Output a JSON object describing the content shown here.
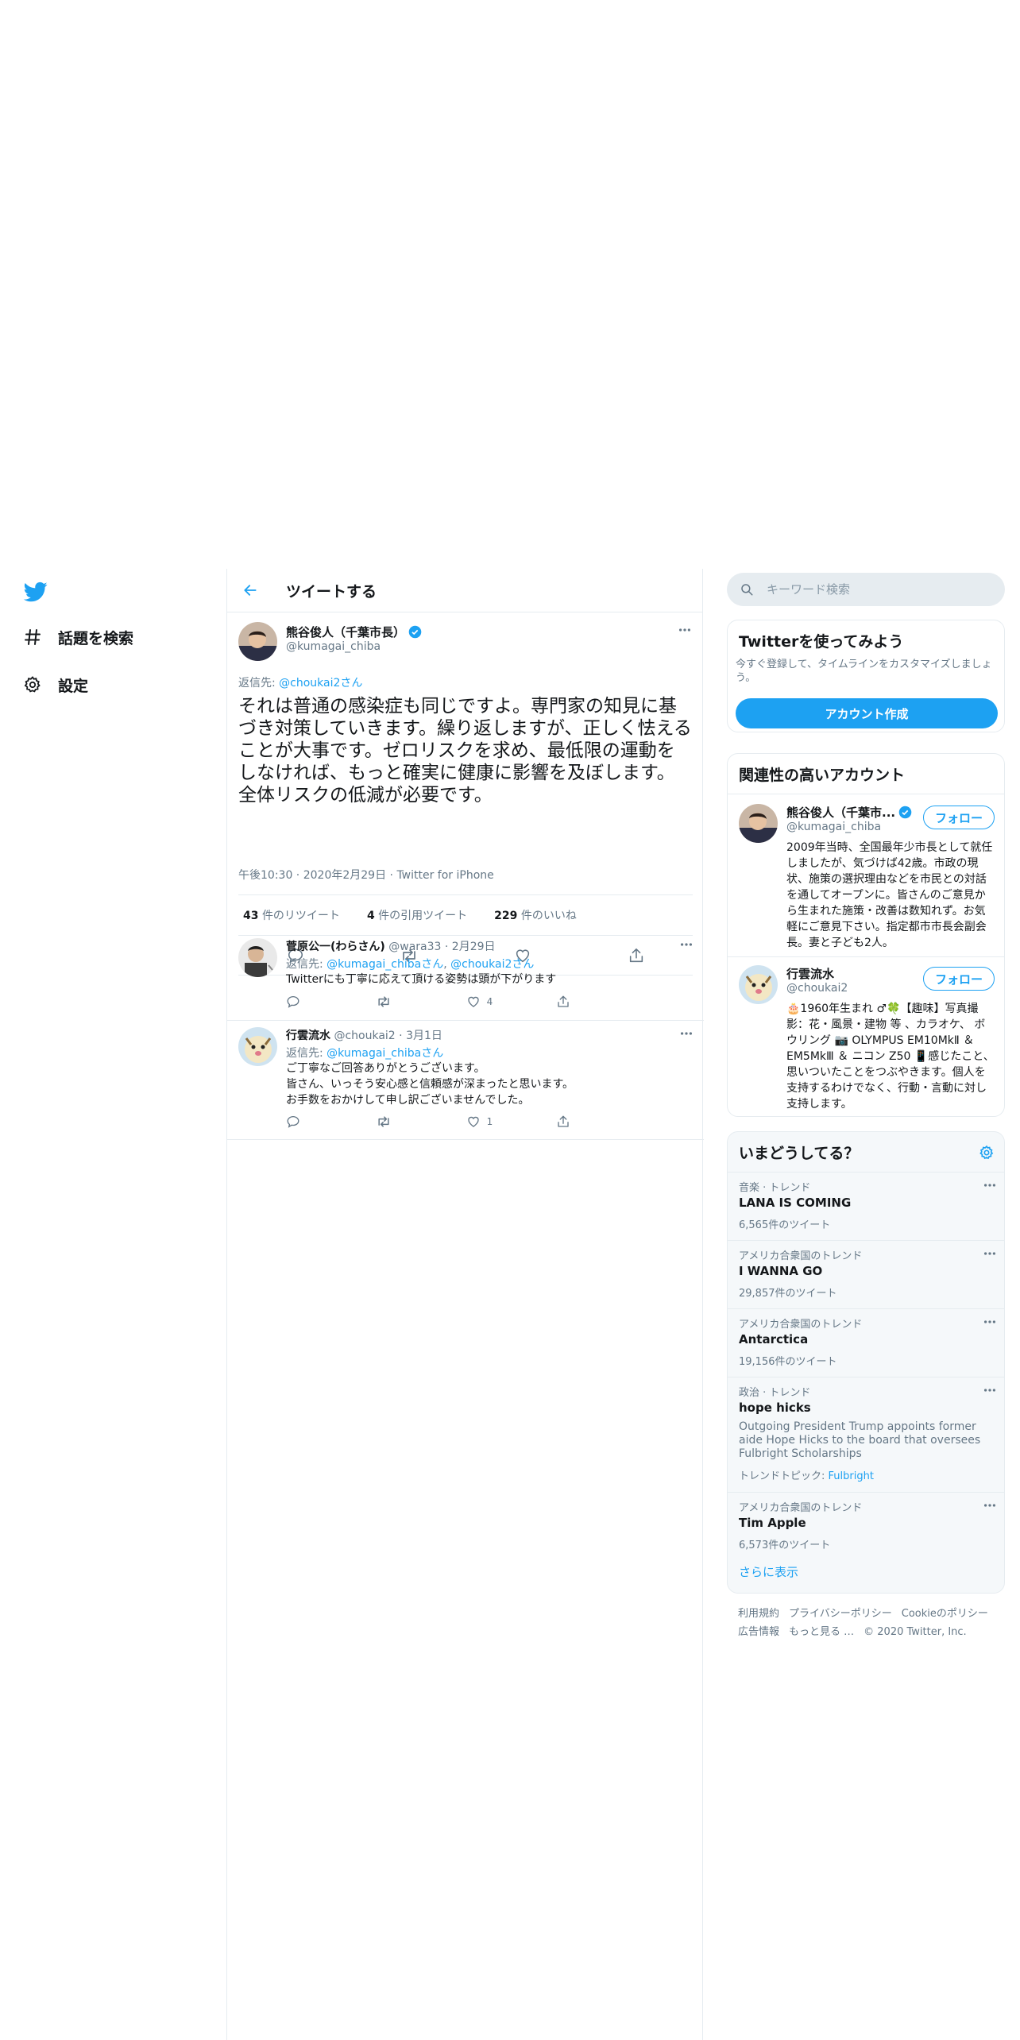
{
  "nav": {
    "explore": "話題を検索",
    "settings": "設定"
  },
  "header": {
    "title": "ツイートする"
  },
  "main_tweet": {
    "name": "熊谷俊人（千葉市長）",
    "handle": "@kumagai_chiba",
    "reply_prefix": "返信先: ",
    "reply_to": "@choukai2さん",
    "text": "それは普通の感染症も同じですよ。専門家の知見に基づき対策していきます。繰り返しますが、正しく怯えることが大事です。ゼロリスクを求め、最低限の運動をしなければ、もっと確実に健康に影響を及ぼします。全体リスクの低減が必要です。",
    "time": "午後10:30",
    "date": "2020年2月29日",
    "source": "Twitter for iPhone",
    "retweets_num": "43",
    "retweets_lbl": "件のリツイート",
    "quotes_num": "4",
    "quotes_lbl": "件の引用ツイート",
    "likes_num": "229",
    "likes_lbl": "件のいいね"
  },
  "replies": [
    {
      "name": "菅原公一(わらさん)",
      "handle": "@wara33",
      "date": "2月29日",
      "reply_prefix": "返信先: ",
      "reply_to_1": "@kumagai_chibaさん",
      "reply_to_sep": ", ",
      "reply_to_2": "@choukai2さん",
      "lines": [
        "Twitterにも丁寧に応えて頂ける姿勢は頭が下がります"
      ],
      "like_count": "4"
    },
    {
      "name": "行雲流水",
      "handle": "@choukai2",
      "date": "3月1日",
      "reply_prefix": "返信先: ",
      "reply_to_1": "@kumagai_chibaさん",
      "lines": [
        "ご丁寧なご回答ありがとうございます。",
        "皆さん、いっそう安心感と信頼感が深まったと思います。",
        "お手数をおかけして申し訳ございませんでした。"
      ],
      "like_count": "1"
    }
  ],
  "search": {
    "placeholder": "キーワード検索"
  },
  "join": {
    "title": "Twitterを使ってみよう",
    "subtitle": "今すぐ登録して、タイムラインをカスタマイズしましょう。",
    "button": "アカウント作成"
  },
  "who_to_follow": {
    "title": "関連性の高いアカウント",
    "follow_label": "フォロー",
    "accounts": [
      {
        "name": "熊谷俊人（千葉市...",
        "handle": "@kumagai_chiba",
        "bio": "2009年当時、全国最年少市長として就任しましたが、気づけば42歳。市政の現状、施策の選択理由などを市民との対話を通してオープンに。皆さんのご意見から生まれた施策・改善は数知れず。お気軽にご意見下さい。指定都市市長会副会長。妻と子ども2人。"
      },
      {
        "name": "行雲流水",
        "handle": "@choukai2",
        "bio": "🎂1960年生まれ ♂🍀【趣味】写真撮影：花・風景・建物 等 、カラオケ、 ボウリング 📷 OLYMPUS EM10MkⅡ ＆ EM5MkⅢ ＆ ニコン Z50 📱感じたこと、思いついたことをつぶやきます。個人を支持するわけでなく、行動・言動に対し支持します。"
      }
    ]
  },
  "trends": {
    "title": "いまどうしてる？",
    "items": [
      {
        "context": "音楽 · トレンド",
        "name": "LANA IS COMING",
        "count": "6,565件のツイート"
      },
      {
        "context": "アメリカ合衆国のトレンド",
        "name": "I WANNA GO",
        "count": "29,857件のツイート"
      },
      {
        "context": "アメリカ合衆国のトレンド",
        "name": "Antarctica",
        "count": "19,156件のツイート"
      },
      {
        "context": "政治 · トレンド",
        "name": "hope hicks",
        "description": "Outgoing President Trump appoints former aide Hope Hicks to the board that oversees Fulbright Scholarships",
        "topic_prefix": "トレンドトピック: ",
        "topic": "Fulbright"
      },
      {
        "context": "アメリカ合衆国のトレンド",
        "name": "Tim Apple",
        "count": "6,573件のツイート"
      }
    ],
    "show_more": "さらに表示"
  },
  "footer": {
    "links": [
      "利用規約",
      "プライバシーポリシー",
      "Cookieのポリシー",
      "広告情報",
      "もっと見る …"
    ],
    "copyright": "© 2020 Twitter, Inc."
  },
  "colors": {
    "accent": "#1da1f2",
    "text": "#14171a",
    "secondary": "#657786",
    "border": "#e6ecf0"
  }
}
